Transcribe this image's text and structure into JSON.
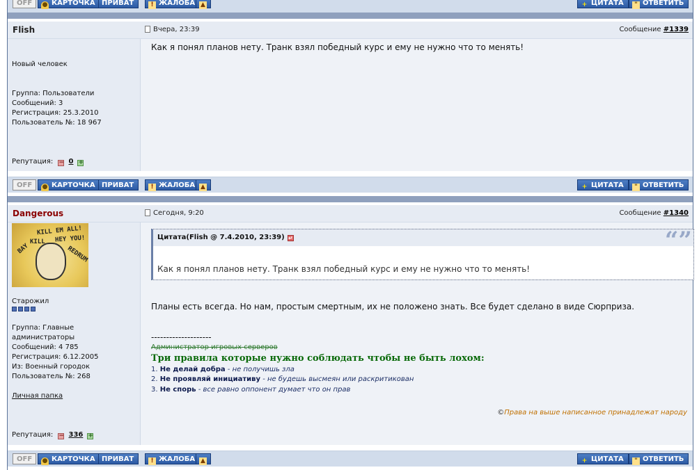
{
  "buttons": {
    "off": "OFF",
    "card": "КАРТОЧКА",
    "private": "ПРИВАТ",
    "report": "ЖАЛОБА",
    "quote": "ЦИТАТА",
    "reply": "ОТВЕТИТЬ"
  },
  "icons": {
    "card": "user-icon",
    "report": "warning-icon",
    "up": "arrow-up-icon",
    "quote": "plus-icon",
    "reply": "quote-mark-icon",
    "doc": "document-icon",
    "rep_minus": "minus-icon",
    "rep_plus": "plus-icon"
  },
  "colors": {
    "button_blue": "#2c5aa4",
    "separator": "#8fa0bd",
    "panel": "#e6ebf3",
    "admin_name": "#8b0000",
    "signature_green": "#0a6a0a"
  },
  "posts": [
    {
      "author": "Flish",
      "date": "Вчера, 23:39",
      "msg_label": "Сообщение",
      "msg_number": "#1339",
      "rank": "Новый человек",
      "group": "Группа: Пользователи",
      "messages": "Сообщений: 3",
      "registered": "Регистрация: 25.3.2010",
      "user_no": "Пользователь №: 18 967",
      "rep_label": "Репутация:",
      "rep_value": "0",
      "text": "Как я понял планов нету. Транк взял победный курс и ему не нужно что то менять!"
    },
    {
      "author": "Dangerous",
      "date": "Сегодня, 9:20",
      "msg_label": "Сообщение",
      "msg_number": "#1340",
      "rank": "Старожил",
      "stars": 4,
      "group_line1": "Группа: Главные",
      "group_line2": "администраторы",
      "messages": "Сообщений: 4 785",
      "registered": "Регистрация: 6.12.2005",
      "from": "Из: Военный городок",
      "user_no": "Пользователь №: 268",
      "folder_link": "Личная папка",
      "rep_label": "Репутация:",
      "rep_value": "336",
      "avatar_words": [
        "KILL EM ALL!",
        "HEY YOU!",
        "BAY",
        "KILL",
        "REDRUM"
      ],
      "quote": {
        "header": "Цитата(Flish @ 7.4.2010, 23:39)",
        "body": "Как я понял планов нету. Транк взял победный курс и ему не нужно что то менять!"
      },
      "text": "Планы есть всегда. Но нам, простым смертным, их не положено знать. Все будет сделано в виде Сюрприза.",
      "signature": {
        "dashes": "--------------------",
        "strike": "Администратор игровых серверов",
        "title": "Три правила которые нужно соблюдать чтобы не быть лохом:",
        "rules": [
          {
            "n": "1.",
            "bold": "Не делай добра",
            "rest": " - не получишь зла"
          },
          {
            "n": "2.",
            "bold": "Не проявляй инициативу",
            "rest": " - не будешь высмеян или раскритикован"
          },
          {
            "n": "3.",
            "bold": "Не спорь",
            "rest": " - все равно оппонент думает что он прав"
          }
        ],
        "copyright_sign": "©",
        "rights": "Права на выше написанное принадлежат народу"
      }
    }
  ]
}
